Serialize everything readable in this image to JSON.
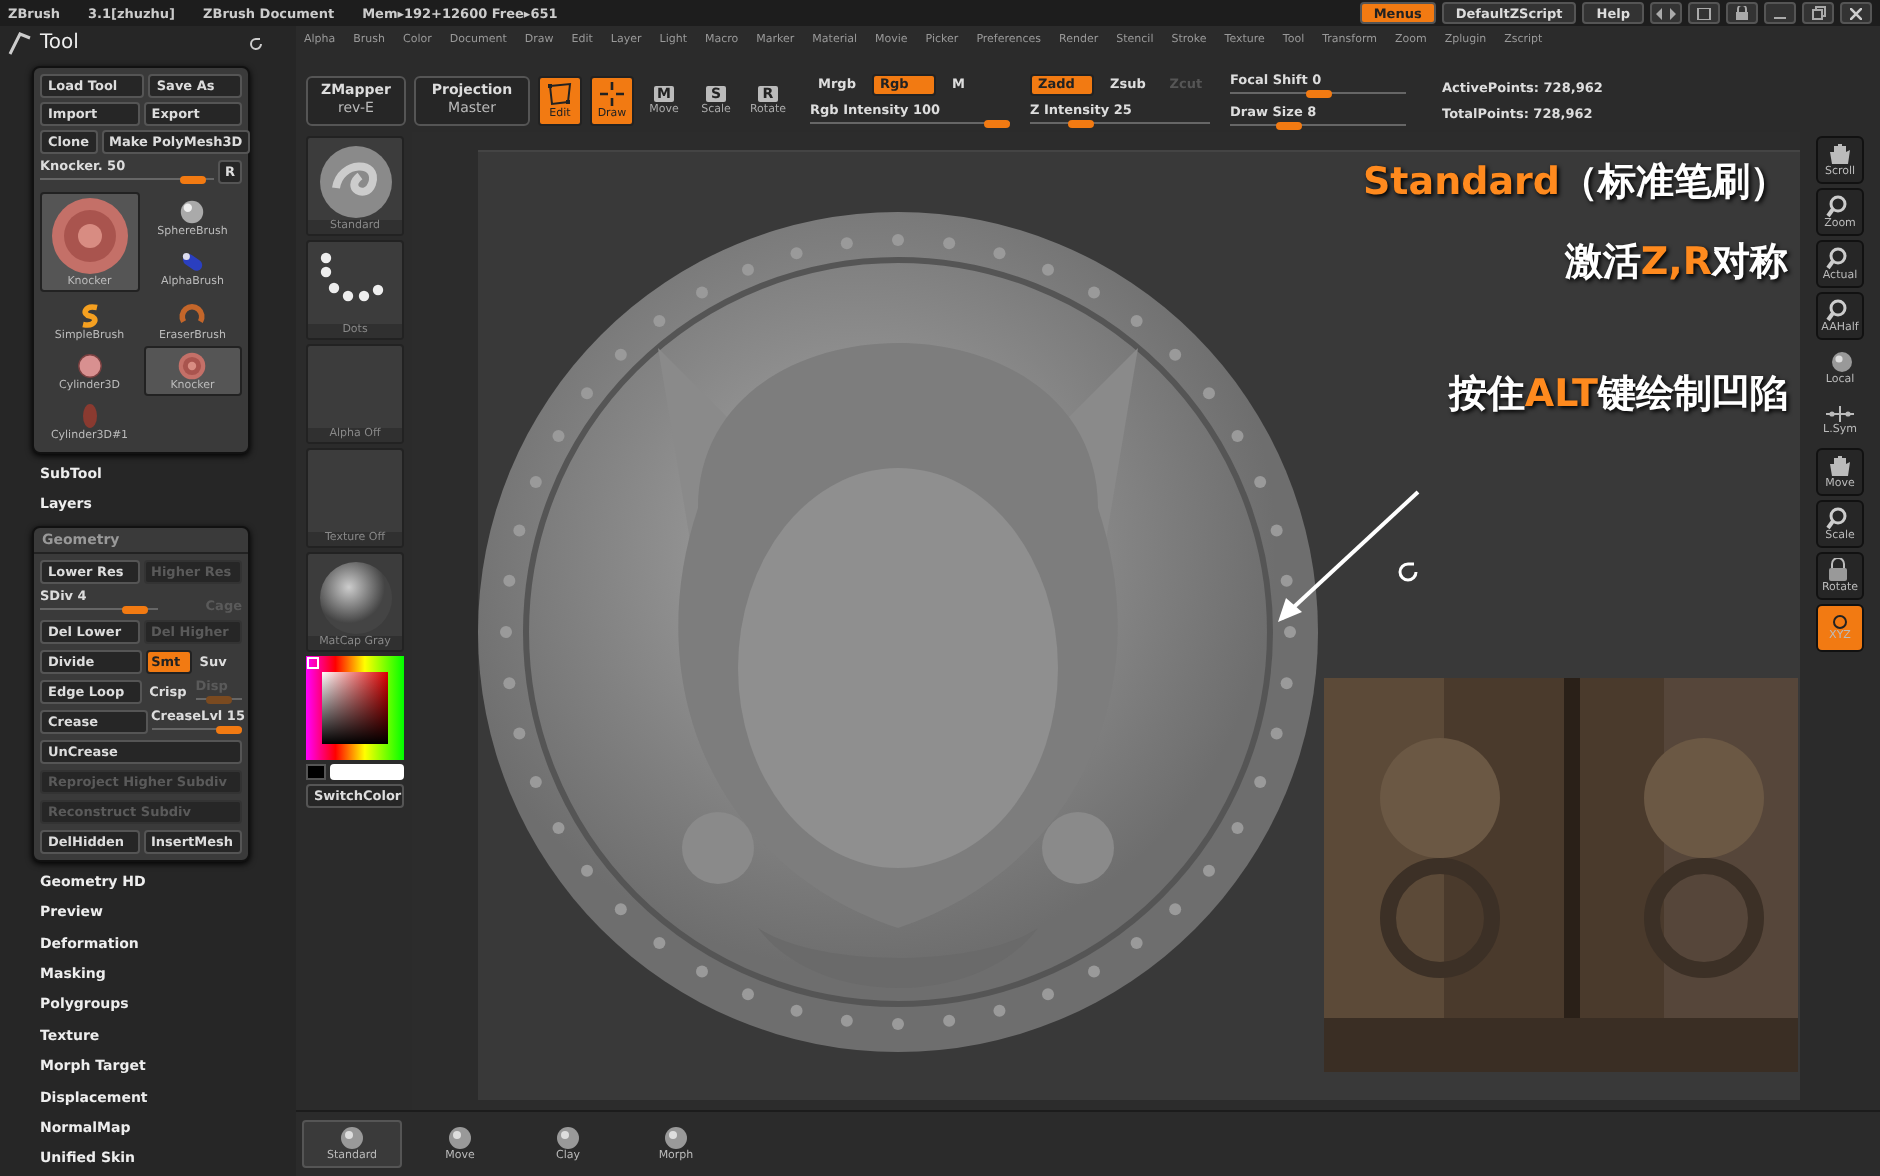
{
  "title_bar": {
    "app": "ZBrush",
    "version": "3.1[zhuzhu]",
    "document": "ZBrush Document",
    "memory": "Mem▸192+12600 Free▸651",
    "buttons": [
      {
        "label": "Menus",
        "selected": true
      },
      {
        "label": "DefaultZScript",
        "selected": false
      },
      {
        "label": "Help",
        "selected": false
      }
    ]
  },
  "menu_bar": [
    "Alpha",
    "Brush",
    "Color",
    "Document",
    "Draw",
    "Edit",
    "Layer",
    "Light",
    "Macro",
    "Marker",
    "Material",
    "Movie",
    "Picker",
    "Preferences",
    "Render",
    "Stencil",
    "Stroke",
    "Texture",
    "Tool",
    "Transform",
    "Zoom",
    "Zplugin",
    "Zscript"
  ],
  "tool_panel": {
    "title": "Tool",
    "buttons": [
      [
        "Load Tool",
        "Save As"
      ],
      [
        "Import",
        "Export"
      ],
      [
        "Clone",
        "Make PolyMesh3D"
      ]
    ],
    "slider": {
      "label": "Knocker. 50",
      "level": 0.95
    },
    "reset": "R",
    "current_tool": {
      "label": "Knocker",
      "kind": "disc"
    },
    "tools": [
      {
        "label": "SphereBrush",
        "kind": "sphere",
        "selected": false
      },
      {
        "label": "AlphaBrush",
        "kind": "capsule",
        "selected": false
      },
      {
        "label": "SimpleBrush",
        "kind": "swirl",
        "selected": false
      },
      {
        "label": "EraserBrush",
        "kind": "ring",
        "selected": false
      },
      {
        "label": "Cylinder3D",
        "kind": "round",
        "selected": false
      },
      {
        "label": "Knocker",
        "kind": "disc",
        "selected": true
      },
      {
        "label": "Cylinder3D#1",
        "kind": "oval",
        "selected": false
      }
    ]
  },
  "sections_before": [
    "SubTool",
    "Layers"
  ],
  "geometry": {
    "title": "Geometry",
    "rows": [
      [
        {
          "kind": "button",
          "label": "Lower Res",
          "disabled": false
        },
        {
          "kind": "button",
          "label": "Higher Res",
          "disabled": true
        }
      ],
      [
        {
          "kind": "slider",
          "label": "SDiv 4",
          "level": 0.9,
          "disabled": false
        },
        {
          "kind": "label",
          "label": "Cage",
          "disabled": true
        }
      ],
      [
        {
          "kind": "button",
          "label": "Del Lower",
          "disabled": false
        },
        {
          "kind": "button",
          "label": "Del Higher",
          "disabled": true
        }
      ],
      [
        {
          "kind": "button",
          "label": "Divide",
          "disabled": false
        },
        {
          "kind": "toggle",
          "label": "Smt",
          "selected": true
        },
        {
          "kind": "toggle",
          "label": "Suv",
          "selected": false
        }
      ],
      [
        {
          "kind": "button",
          "label": "Edge Loop",
          "disabled": false
        },
        {
          "kind": "toggle",
          "label": "Crisp",
          "selected": false
        },
        {
          "kind": "mini-slider",
          "label": "Disp",
          "level": 0.5,
          "disabled": true
        }
      ],
      [
        {
          "kind": "button",
          "label": "Crease",
          "disabled": false
        },
        {
          "kind": "slider",
          "label": "CreaseLvl 15",
          "level": 1,
          "disabled": false
        }
      ],
      [
        {
          "kind": "wide",
          "label": "UnCrease",
          "disabled": false
        }
      ],
      [
        {
          "kind": "wide",
          "label": "Reproject Higher Subdiv",
          "disabled": true
        }
      ],
      [
        {
          "kind": "wide",
          "label": "Reconstruct Subdiv",
          "disabled": true
        }
      ],
      [
        {
          "kind": "button",
          "label": "DelHidden",
          "disabled": false
        },
        {
          "kind": "button",
          "label": "InsertMesh",
          "disabled": false
        }
      ]
    ]
  },
  "sections_after": [
    "Geometry HD",
    "Preview",
    "Deformation",
    "Masking",
    "Polygroups",
    "Texture",
    "Morph Target",
    "Displacement",
    "NormalMap",
    "Unified Skin"
  ],
  "toolbar": {
    "menus": [
      {
        "label": "ZMapper",
        "sublabel": "rev-E"
      },
      {
        "label": "Projection",
        "sublabel": "Master"
      }
    ],
    "modes": [
      {
        "label": "Edit",
        "kind": "edit",
        "selected": true
      },
      {
        "label": "Draw",
        "kind": "draw",
        "selected": true
      },
      {
        "label": "Move",
        "kind": "letter",
        "glyph": "M",
        "selected": false
      },
      {
        "label": "Scale",
        "kind": "letter",
        "glyph": "S",
        "selected": false
      },
      {
        "label": "Rotate",
        "kind": "letter",
        "glyph": "R",
        "selected": false
      }
    ],
    "rgb": {
      "toggles": [
        {
          "label": "Mrgb",
          "selected": false,
          "disabled": false
        },
        {
          "label": "Rgb",
          "selected": true,
          "disabled": false
        },
        {
          "label": "M",
          "selected": false,
          "disabled": false
        }
      ],
      "slider": {
        "label": "Rgb Intensity 100",
        "level": 1
      }
    },
    "z": {
      "toggles": [
        {
          "label": "Zadd",
          "selected": true,
          "disabled": false
        },
        {
          "label": "Zsub",
          "selected": false,
          "disabled": false
        },
        {
          "label": "Zcut",
          "selected": false,
          "disabled": true
        }
      ],
      "slider": {
        "label": "Z Intensity 25",
        "level": 0.25
      }
    },
    "sliders": [
      {
        "label": "Focal Shift 0",
        "level": 0.5
      },
      {
        "label": "Draw Size 8",
        "level": 0.3
      }
    ],
    "stats": [
      "ActivePoints: 728,962",
      "TotalPoints: 728,962"
    ]
  },
  "left_shelf": {
    "items": [
      {
        "label": "Standard",
        "kind": "brush"
      },
      {
        "label": "Dots",
        "kind": "dots"
      },
      {
        "label": "Alpha Off",
        "kind": "empty"
      },
      {
        "label": "Texture Off",
        "kind": "empty"
      },
      {
        "label": "MatCap Gray",
        "kind": "sphere"
      }
    ],
    "switch": "SwitchColor"
  },
  "right_shelf": [
    {
      "label": "Scroll",
      "kind": "hand",
      "boxed": true,
      "selected": false
    },
    {
      "label": "Zoom",
      "kind": "magnifier",
      "boxed": true,
      "selected": false
    },
    {
      "label": "Actual",
      "kind": "magnifier",
      "boxed": true,
      "selected": false
    },
    {
      "label": "AAHalf",
      "kind": "magnifier",
      "boxed": true,
      "selected": false
    },
    {
      "label": "Local",
      "kind": "sphere",
      "boxed": false,
      "selected": false
    },
    {
      "label": "L.Sym",
      "kind": "axes",
      "boxed": false,
      "selected": false
    },
    {
      "label": "Move",
      "kind": "hand",
      "boxed": true,
      "selected": false
    },
    {
      "label": "Scale",
      "kind": "magnifier",
      "boxed": true,
      "selected": false
    },
    {
      "label": "Rotate",
      "kind": "lock",
      "boxed": true,
      "selected": false
    },
    {
      "label": "XYZ",
      "kind": "xyz",
      "boxed": true,
      "selected": true
    }
  ],
  "annotations": [
    {
      "parts": [
        {
          "text": "Standard",
          "highlight": true
        },
        {
          "text": "（标准笔刷）",
          "highlight": false
        }
      ]
    },
    {
      "parts": [
        {
          "text": "激活",
          "highlight": false
        },
        {
          "text": "Z,R",
          "highlight": true
        },
        {
          "text": "对称",
          "highlight": false
        }
      ]
    },
    {
      "parts": [
        {
          "text": "按住",
          "highlight": false
        },
        {
          "text": "ALT",
          "highlight": true
        },
        {
          "text": "键绘制凹陷",
          "highlight": false
        }
      ]
    }
  ],
  "inset": {
    "kind": "picture"
  },
  "bottom_bar": [
    {
      "label": "Standard",
      "selected": true
    },
    {
      "label": "Move",
      "selected": false
    },
    {
      "label": "Clay",
      "selected": false
    },
    {
      "label": "Morph",
      "selected": false
    }
  ]
}
